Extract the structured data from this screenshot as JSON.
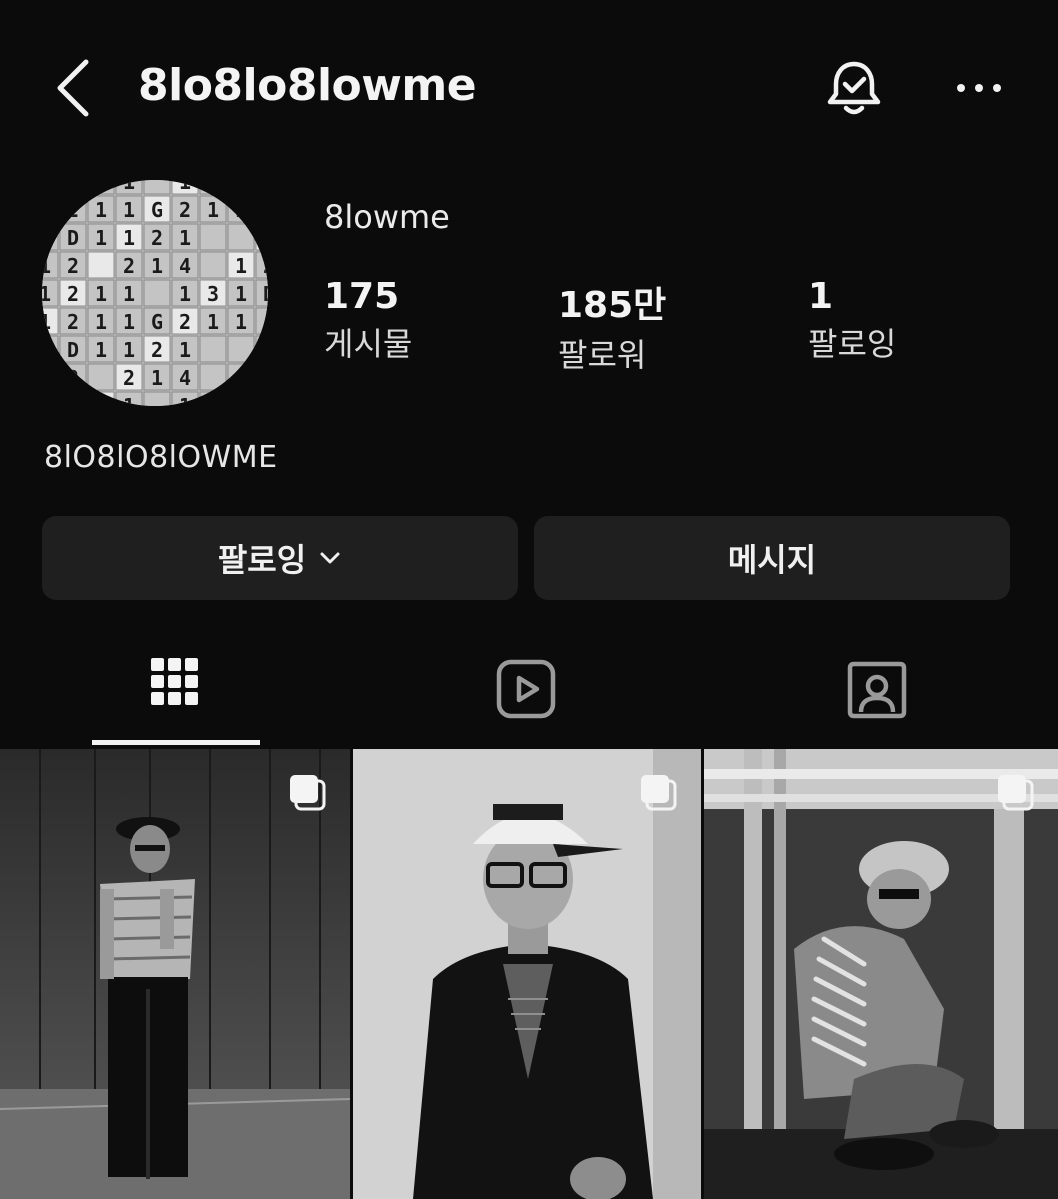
{
  "header": {
    "username": "8lo8lo8lowme"
  },
  "profile": {
    "display_name": "8lowme",
    "stats": [
      {
        "value": "175",
        "label": "게시물"
      },
      {
        "value": "185만",
        "label": "팔로워"
      },
      {
        "value": "1",
        "label": "팔로잉"
      }
    ],
    "bio_name": "8lO8lO8lOWME"
  },
  "actions": {
    "following_label": "팔로잉",
    "message_label": "메시지"
  },
  "tabs": [
    {
      "icon": "grid-icon",
      "active": true
    },
    {
      "icon": "reels-icon",
      "active": false
    },
    {
      "icon": "tagged-icon",
      "active": false
    }
  ],
  "posts": [
    {
      "icon": "carousel-icon"
    },
    {
      "icon": "carousel-icon"
    },
    {
      "icon": "carousel-icon"
    }
  ],
  "colors": {
    "background": "#0b0b0b",
    "button_bg": "#1f1f1f",
    "text": "#f2f2f2"
  }
}
